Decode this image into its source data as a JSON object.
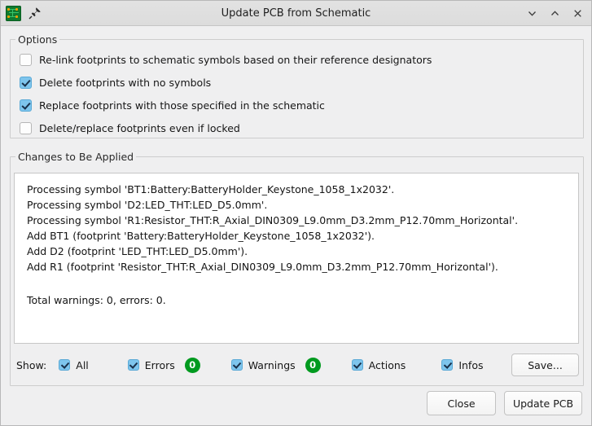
{
  "window": {
    "title": "Update PCB from Schematic",
    "app_icon": "pcb-board-icon",
    "pin_icon": "pushpin-icon",
    "controls": [
      {
        "name": "minimize",
        "icon": "chevron-down-icon"
      },
      {
        "name": "maximize",
        "icon": "chevron-up-icon"
      },
      {
        "name": "close",
        "icon": "close-x-icon"
      }
    ]
  },
  "options": {
    "legend": "Options",
    "items": [
      {
        "label": "Re-link footprints to schematic symbols based on their reference designators",
        "checked": false
      },
      {
        "label": "Delete footprints with no symbols",
        "checked": true
      },
      {
        "label": "Replace footprints with those specified in the schematic",
        "checked": true
      },
      {
        "label": "Delete/replace footprints even if locked",
        "checked": false
      }
    ]
  },
  "changes": {
    "legend": "Changes to Be Applied",
    "lines": [
      "Processing symbol 'BT1:Battery:BatteryHolder_Keystone_1058_1x2032'.",
      "Processing symbol 'D2:LED_THT:LED_D5.0mm'.",
      "Processing symbol 'R1:Resistor_THT:R_Axial_DIN0309_L9.0mm_D3.2mm_P12.70mm_Horizontal'.",
      "Add BT1 (footprint 'Battery:BatteryHolder_Keystone_1058_1x2032').",
      "Add D2 (footprint 'LED_THT:LED_D5.0mm').",
      "Add R1 (footprint 'Resistor_THT:R_Axial_DIN0309_L9.0mm_D3.2mm_P12.70mm_Horizontal')."
    ],
    "summary": "Total warnings: 0, errors: 0."
  },
  "show": {
    "label": "Show:",
    "filters": [
      {
        "label": "All",
        "checked": true,
        "count": null
      },
      {
        "label": "Errors",
        "checked": true,
        "count": "0"
      },
      {
        "label": "Warnings",
        "checked": true,
        "count": "0"
      },
      {
        "label": "Actions",
        "checked": true,
        "count": null
      },
      {
        "label": "Infos",
        "checked": true,
        "count": null
      }
    ],
    "save_label": "Save..."
  },
  "footer": {
    "close_label": "Close",
    "update_label": "Update PCB"
  },
  "colors": {
    "badge_green": "#009a1f",
    "checkbox_blue": "#7ec5ed",
    "titlebar": "#dfdfdf",
    "background": "#efeff0"
  }
}
